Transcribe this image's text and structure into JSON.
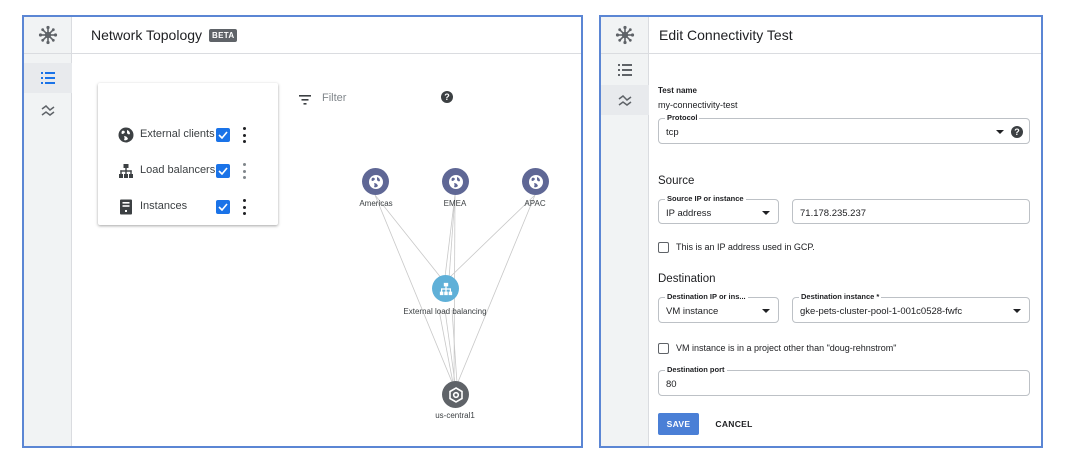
{
  "left_panel": {
    "title": "Network Topology",
    "badge": "BETA",
    "rail_icons": [
      "network-hub-icon",
      "list-view-icon",
      "topology-view-icon"
    ],
    "layers": [
      {
        "label": "External clients",
        "checked": true,
        "icon": "globe-icon"
      },
      {
        "label": "Load balancers",
        "checked": true,
        "icon": "sitemap-icon"
      },
      {
        "label": "Instances",
        "checked": true,
        "icon": "server-icon"
      }
    ],
    "filter_placeholder": "Filter",
    "nodes": {
      "americas": "Americas",
      "emea": "EMEA",
      "apac": "APAC",
      "lb": "External load balancing",
      "region": "us-central1"
    }
  },
  "right_panel": {
    "title": "Edit Connectivity Test",
    "test_name_label": "Test name",
    "test_name_value": "my-connectivity-test",
    "protocol_label": "Protocol",
    "protocol_value": "tcp",
    "source_heading": "Source",
    "source_type_label": "Source IP or instance",
    "source_type_value": "IP address",
    "source_ip_value": "71.178.235.237",
    "source_gcp_checkbox": "This is an IP address used in GCP.",
    "dest_heading": "Destination",
    "dest_type_label": "Destination IP or ins...",
    "dest_type_value": "VM instance",
    "dest_instance_label": "Destination instance *",
    "dest_instance_value": "gke-pets-cluster-pool-1-001c0528-fwfc",
    "dest_other_project_checkbox": "VM instance is in a project other than \"doug-rehnstrom\"",
    "dest_port_label": "Destination port",
    "dest_port_value": "80",
    "save_label": "SAVE",
    "cancel_label": "CANCEL"
  },
  "colors": {
    "panel_border": "#5b86d4",
    "checkbox": "#1a73e8",
    "node_dark": "#5f6795",
    "node_lb": "#5fb0d8",
    "node_region": "#5f6368",
    "save_button": "#4a7fd6"
  }
}
